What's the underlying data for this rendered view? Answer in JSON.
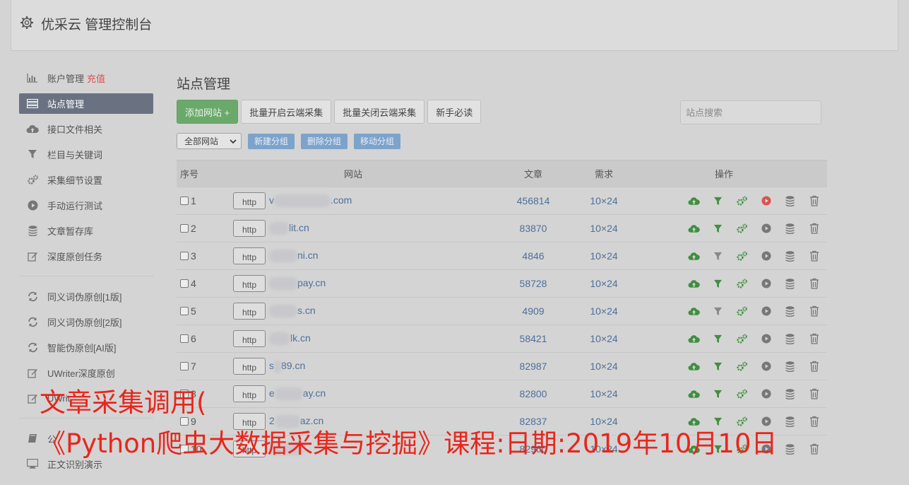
{
  "header": {
    "title": "优采云 管理控制台",
    "icon": "gear-icon"
  },
  "sidebar": {
    "items": [
      {
        "label": "账户管理",
        "extra": "充值",
        "icon": "bar-chart-icon"
      },
      {
        "label": "站点管理",
        "icon": "server-list-icon",
        "active": true
      },
      {
        "label": "接口文件相关",
        "icon": "cloud-upload-icon"
      },
      {
        "label": "栏目与关键词",
        "icon": "filter-icon"
      },
      {
        "label": "采集细节设置",
        "icon": "gears-icon"
      },
      {
        "label": "手动运行测试",
        "icon": "play-circle-icon"
      },
      {
        "label": "文章暂存库",
        "icon": "database-icon"
      },
      {
        "label": "深度原创任务",
        "icon": "edit-icon"
      },
      {
        "label": "同义词伪原创[1版]",
        "icon": "refresh-icon"
      },
      {
        "label": "同义词伪原创[2版]",
        "icon": "refresh-icon"
      },
      {
        "label": "智能伪原创[AI版]",
        "icon": "refresh-icon"
      },
      {
        "label": "UWriter深度原创",
        "icon": "edit-icon"
      },
      {
        "label": "UWrit",
        "icon": "edit-icon"
      },
      {
        "label": "公",
        "icon": "book-icon"
      },
      {
        "label": "正文识别演示",
        "icon": "monitor-icon"
      }
    ]
  },
  "main": {
    "title": "站点管理",
    "toolbar": {
      "add_site": "添加网站 +",
      "batch_open": "批量开启云端采集",
      "batch_close": "批量关闭云端采集",
      "newbie": "新手必读"
    },
    "search_placeholder": "站点搜索",
    "group_select": "全部网站",
    "group_buttons": {
      "new": "新建分组",
      "delete": "删除分组",
      "move": "移动分组"
    },
    "table": {
      "headers": {
        "no": "序号",
        "site": "网站",
        "articles": "文章",
        "demand": "需求",
        "ops": "操作"
      },
      "rows": [
        {
          "no": "1",
          "http": "http",
          "url_prefix": "v",
          "url_suffix": ".com",
          "articles": "456814",
          "demand": "10×24",
          "run_active": true,
          "filter_active": true
        },
        {
          "no": "2",
          "http": "http",
          "url_prefix": "",
          "url_suffix": "lit.cn",
          "articles": "83870",
          "demand": "10×24",
          "run_active": false,
          "filter_active": true
        },
        {
          "no": "3",
          "http": "http",
          "url_prefix": "",
          "url_suffix": "ni.cn",
          "articles": "4846",
          "demand": "10×24",
          "run_active": false,
          "filter_active": false
        },
        {
          "no": "4",
          "http": "http",
          "url_prefix": "",
          "url_suffix": "pay.cn",
          "articles": "58728",
          "demand": "10×24",
          "run_active": false,
          "filter_active": true
        },
        {
          "no": "5",
          "http": "http",
          "url_prefix": "",
          "url_suffix": "s.cn",
          "articles": "4909",
          "demand": "10×24",
          "run_active": false,
          "filter_active": false
        },
        {
          "no": "6",
          "http": "http",
          "url_prefix": "",
          "url_suffix": "lk.cn",
          "articles": "58421",
          "demand": "10×24",
          "run_active": false,
          "filter_active": true
        },
        {
          "no": "7",
          "http": "http",
          "url_prefix": "s",
          "url_suffix": "89.cn",
          "articles": "82987",
          "demand": "10×24",
          "run_active": false,
          "filter_active": true
        },
        {
          "no": "8",
          "http": "http",
          "url_prefix": "e",
          "url_suffix": "ay.cn",
          "articles": "82800",
          "demand": "10×24",
          "run_active": false,
          "filter_active": true
        },
        {
          "no": "9",
          "http": "http",
          "url_prefix": "2",
          "url_suffix": "az.cn",
          "articles": "82837",
          "demand": "10×24",
          "run_active": false,
          "filter_active": true
        },
        {
          "no": "10",
          "http": "http",
          "url_prefix": "",
          "url_suffix": "",
          "articles": "82960",
          "demand": "10×24",
          "run_active": false,
          "filter_active": true
        }
      ]
    }
  },
  "overlay": {
    "line1": "文章采集调用(",
    "line2": "《Python爬虫大数据采集与挖掘》课程:日期:2019年10月10日"
  },
  "colors": {
    "accent_green": "#6aa96a",
    "accent_blue": "#7da3cb",
    "link": "#4e6f9a",
    "caption_red": "#e8261c",
    "run_red": "#d9534f"
  }
}
